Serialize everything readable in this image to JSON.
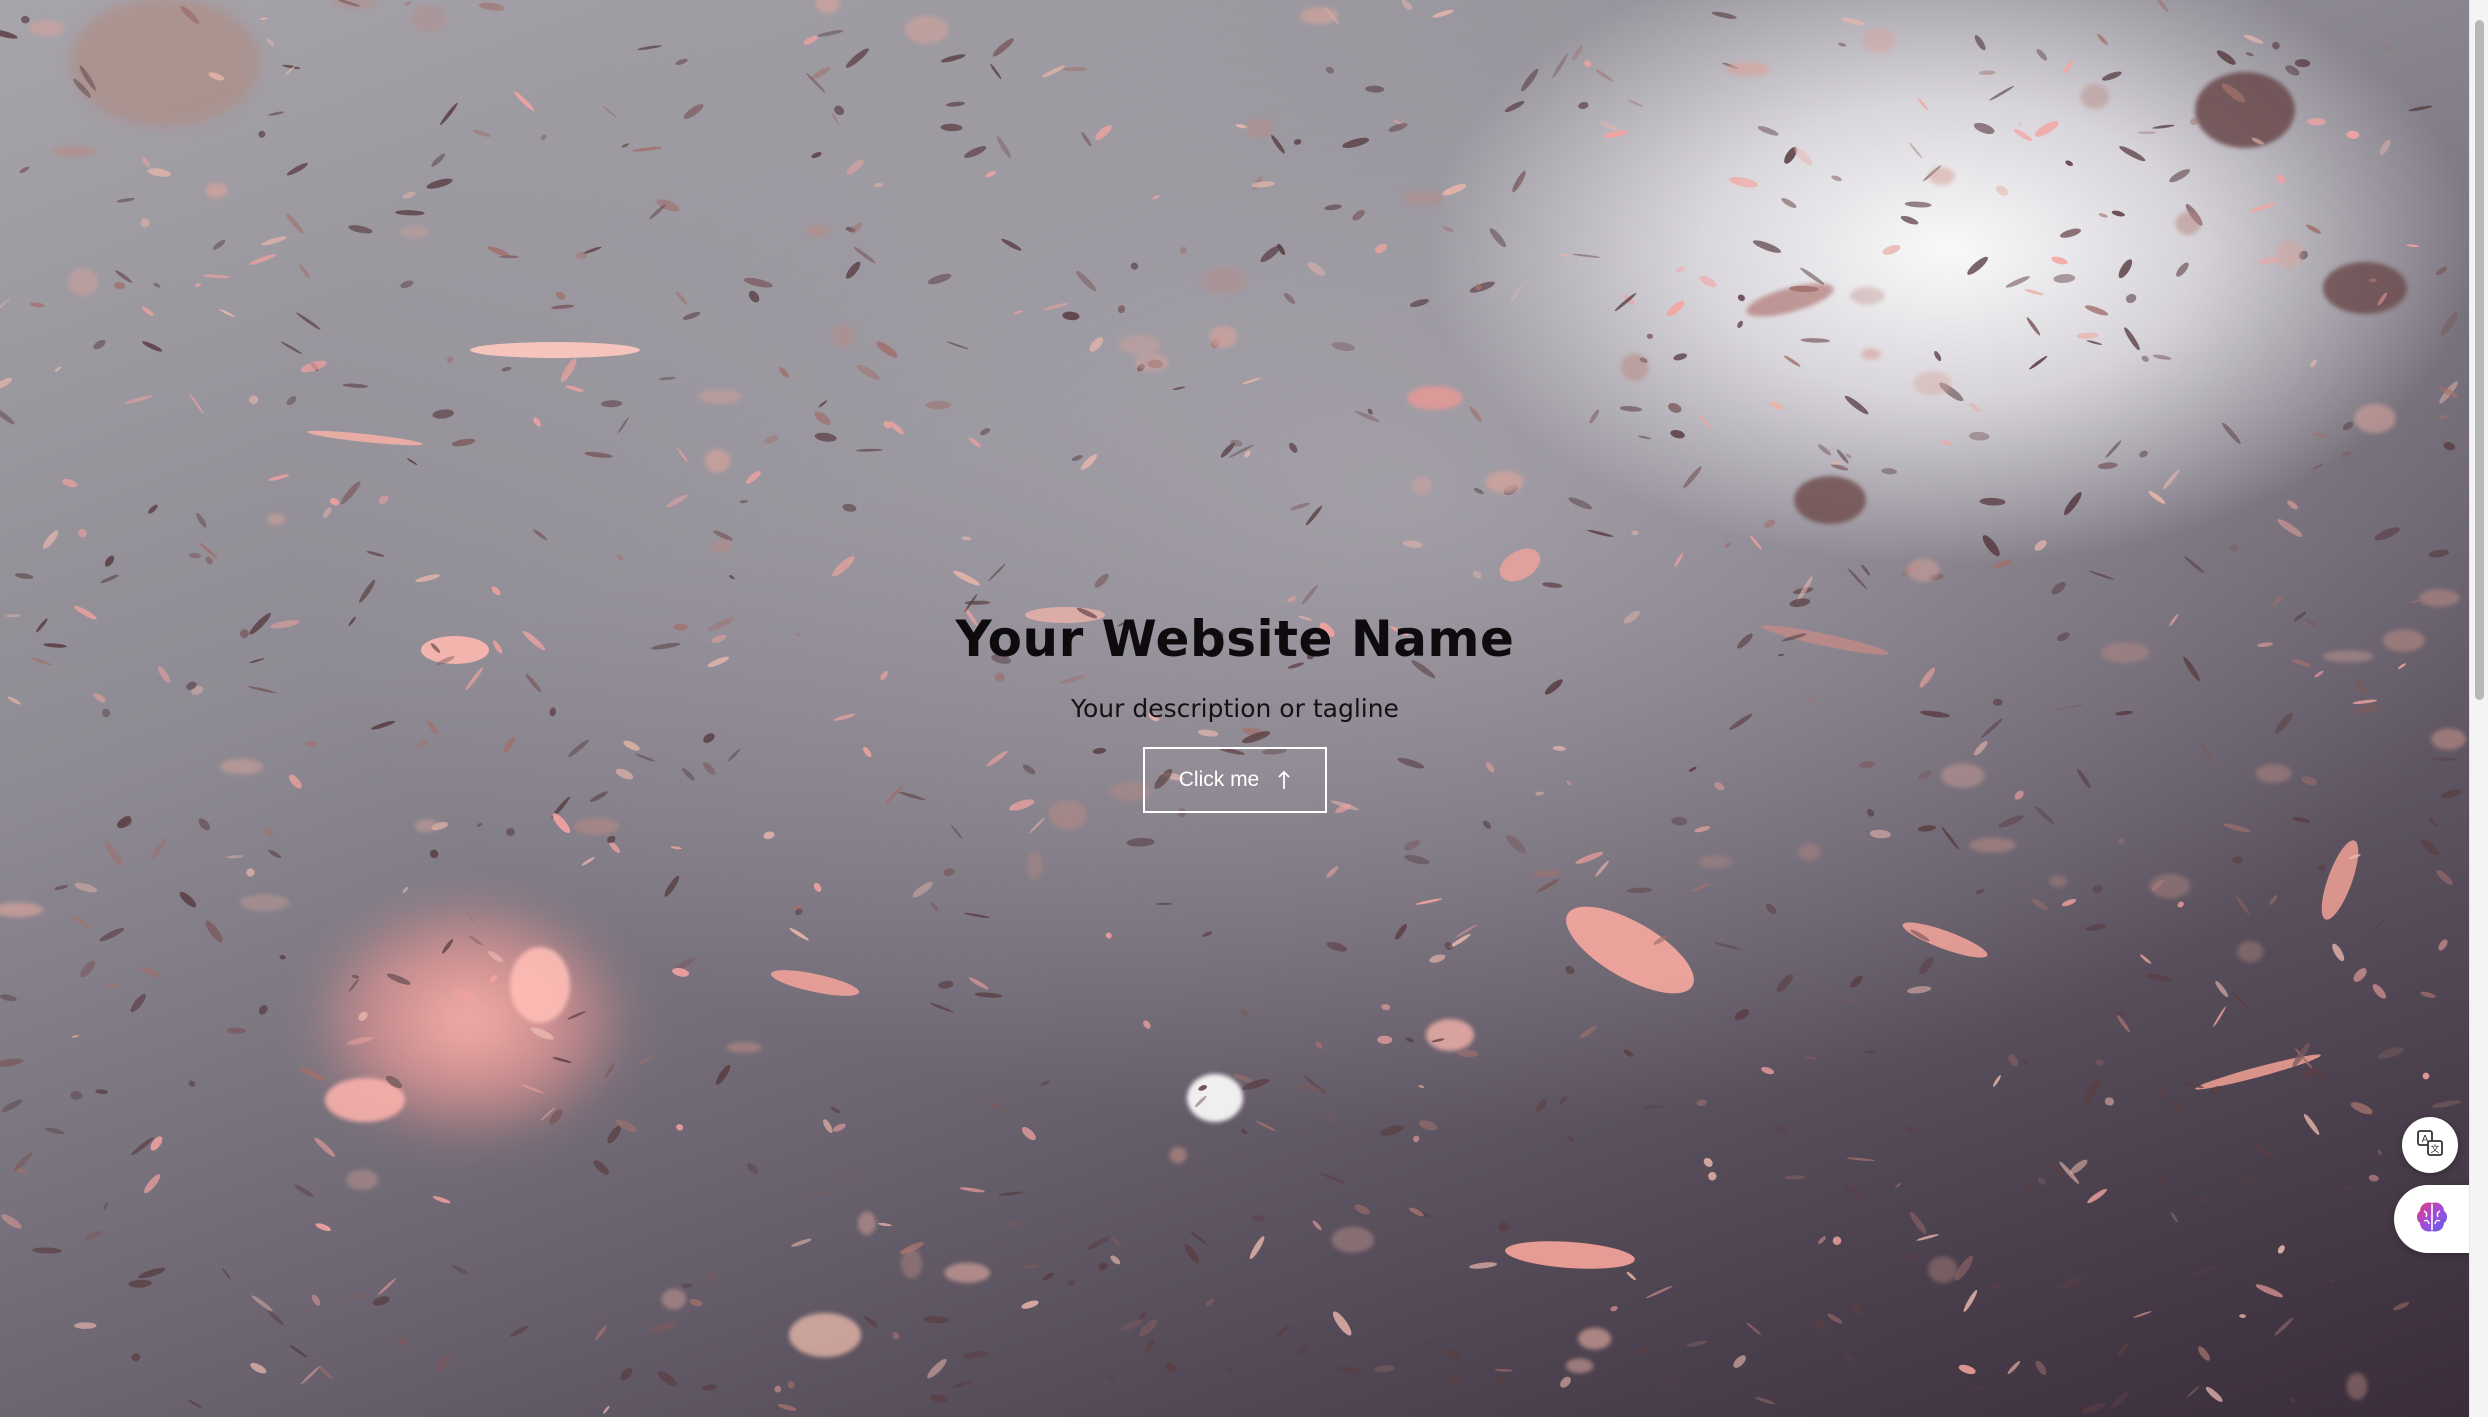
{
  "hero": {
    "title": "Your Website Name",
    "tagline": "Your description or tagline",
    "cta_label": "Click me"
  },
  "background": {
    "theme": "falling pink petals over grey-to-plum gradient",
    "colors": {
      "light": "#f2f0f3",
      "mid": "#8e8a93",
      "dark": "#3a2c3a",
      "petal_pink": "#f4a3a0",
      "petal_dark": "#5a3e44"
    }
  },
  "floating_buttons": {
    "translate_icon": "translate-icon",
    "ai_icon": "brain-icon"
  }
}
